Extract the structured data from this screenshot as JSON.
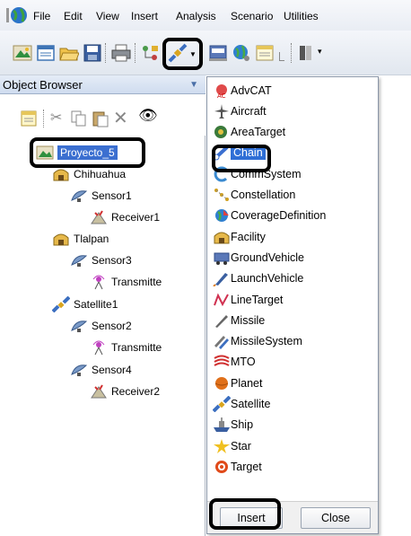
{
  "menu": {
    "file": "File",
    "edit": "Edit",
    "view": "View",
    "insert": "Insert",
    "analysis": "Analysis",
    "scenario": "Scenario",
    "utilities": "Utilities"
  },
  "toolbar_icons": [
    "satellite-toolbar-icon",
    "folder-icon",
    "open-icon",
    "save-icon",
    "print-icon",
    "insert-object-icon",
    "report-icon",
    "globe-icon",
    "graph-icon"
  ],
  "object_browser": {
    "title": "Object Browser",
    "tree": [
      {
        "label": "Proyecto_5",
        "level": 0,
        "icon": "scenario-icon",
        "selected": true
      },
      {
        "label": "Chihuahua",
        "level": 1,
        "icon": "facility-icon"
      },
      {
        "label": "Sensor1",
        "level": 2,
        "icon": "sensor-icon"
      },
      {
        "label": "Receiver1",
        "level": 3,
        "icon": "receiver-icon"
      },
      {
        "label": "Tlalpan",
        "level": 1,
        "icon": "facility-icon"
      },
      {
        "label": "Sensor3",
        "level": 2,
        "icon": "sensor-icon"
      },
      {
        "label": "Transmitte",
        "level": 3,
        "icon": "transmitter-icon"
      },
      {
        "label": "Satellite1",
        "level": 1,
        "icon": "satellite-icon"
      },
      {
        "label": "Sensor2",
        "level": 2,
        "icon": "sensor-icon"
      },
      {
        "label": "Transmitte",
        "level": 3,
        "icon": "transmitter-icon"
      },
      {
        "label": "Sensor4",
        "level": 2,
        "icon": "sensor-icon"
      },
      {
        "label": "Receiver2",
        "level": 3,
        "icon": "receiver-icon"
      }
    ]
  },
  "insert_menu": {
    "items": [
      {
        "label": "AdvCAT",
        "icon": "advcat-icon"
      },
      {
        "label": "Aircraft",
        "icon": "aircraft-icon"
      },
      {
        "label": "AreaTarget",
        "icon": "areatarget-icon"
      },
      {
        "label": "Chain",
        "icon": "chain-icon",
        "selected": true
      },
      {
        "label": "CommSystem",
        "icon": "commsystem-icon"
      },
      {
        "label": "Constellation",
        "icon": "constellation-icon"
      },
      {
        "label": "CoverageDefinition",
        "icon": "coverage-icon"
      },
      {
        "label": "Facility",
        "icon": "facility-icon"
      },
      {
        "label": "GroundVehicle",
        "icon": "groundvehicle-icon"
      },
      {
        "label": "LaunchVehicle",
        "icon": "launchvehicle-icon"
      },
      {
        "label": "LineTarget",
        "icon": "linetarget-icon"
      },
      {
        "label": "Missile",
        "icon": "missile-icon"
      },
      {
        "label": "MissileSystem",
        "icon": "missilesystem-icon"
      },
      {
        "label": "MTO",
        "icon": "mto-icon"
      },
      {
        "label": "Planet",
        "icon": "planet-icon"
      },
      {
        "label": "Satellite",
        "icon": "satellite-icon"
      },
      {
        "label": "Ship",
        "icon": "ship-icon"
      },
      {
        "label": "Star",
        "icon": "star-icon"
      },
      {
        "label": "Target",
        "icon": "target-icon"
      }
    ],
    "insert_button": "Insert",
    "close_button": "Close"
  },
  "colors": {
    "selection": "#3b6fd0",
    "menu_selection": "#2f6fd6",
    "header": "#cfdcef"
  }
}
